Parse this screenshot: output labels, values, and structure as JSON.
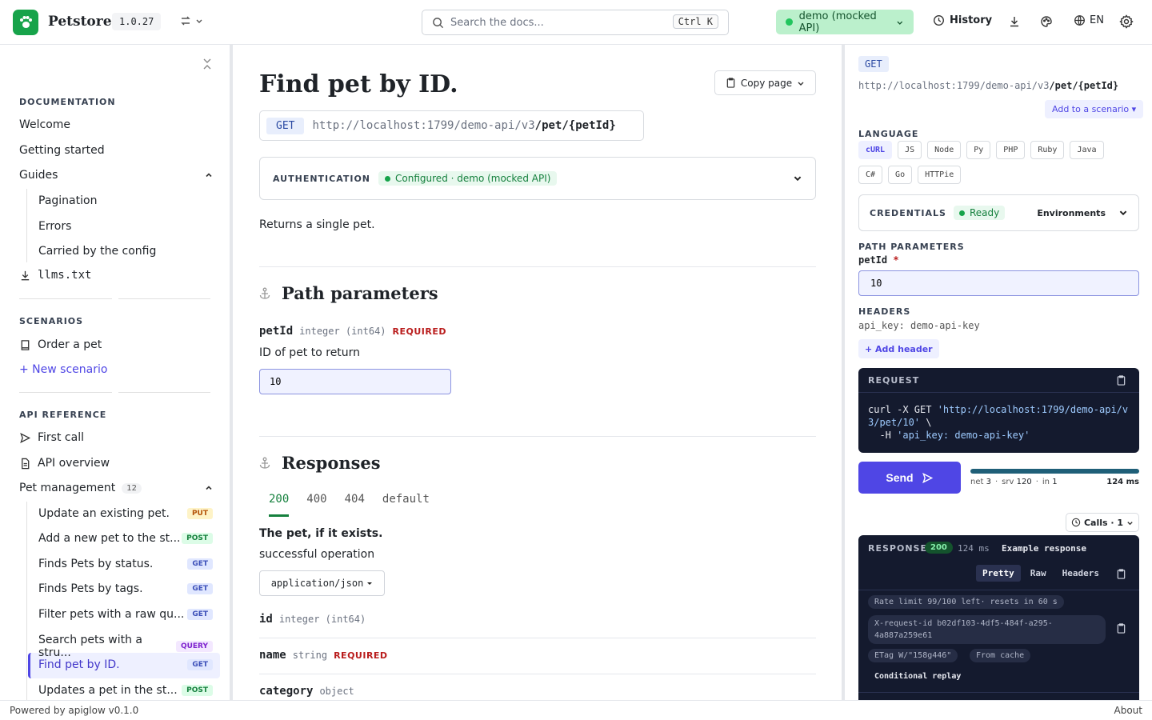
{
  "header": {
    "brand": "Petstore",
    "version": "1.0.27",
    "search_placeholder": "Search the docs...",
    "search_shortcut": "Ctrl K",
    "environment": "demo (mocked API)",
    "history_label": "History",
    "language": "EN"
  },
  "sidebar": {
    "documentation_heading": "DOCUMENTATION",
    "documentation_items": [
      "Welcome",
      "Getting started",
      "Guides"
    ],
    "guides_children": [
      "Pagination",
      "Errors",
      "Carried by the config"
    ],
    "llms_label": "llms.txt",
    "scenarios_heading": "SCENARIOS",
    "scenario_item": "Order a pet",
    "new_scenario": "+ New scenario",
    "api_heading": "API REFERENCE",
    "first_call": "First call",
    "api_overview": "API overview",
    "pet_group": "Pet management",
    "pet_group_count": "12",
    "endpoints": [
      {
        "label": "Update an existing pet.",
        "method": "PUT"
      },
      {
        "label": "Add a new pet to the st...",
        "method": "POST"
      },
      {
        "label": "Finds Pets by status.",
        "method": "GET"
      },
      {
        "label": "Finds Pets by tags.",
        "method": "GET"
      },
      {
        "label": "Filter pets with a raw qu...",
        "method": "GET"
      },
      {
        "label": "Search pets with a stru...",
        "method": "QUERY"
      },
      {
        "label": "Find pet by ID.",
        "method": "GET"
      },
      {
        "label": "Updates a pet in the st...",
        "method": "POST"
      }
    ]
  },
  "main": {
    "title": "Find pet by ID.",
    "copy_label": "Copy page",
    "method": "GET",
    "url_base": "http://localhost:1799/demo-api/v3",
    "url_path": "/pet/{petId}",
    "auth_label": "AUTHENTICATION",
    "auth_status": "Configured · demo (mocked API)",
    "description": "Returns a single pet.",
    "path_params_heading": "Path parameters",
    "param_name": "petId",
    "param_type": "integer (int64)",
    "param_required": "REQUIRED",
    "param_desc": "ID of pet to return",
    "param_value": "10",
    "responses_heading": "Responses",
    "response_codes": [
      "200",
      "400",
      "404",
      "default"
    ],
    "response_title": "The pet, if it exists.",
    "response_desc": "successful operation",
    "content_type": "application/json",
    "fields": [
      {
        "name": "id",
        "type": "integer (int64)",
        "required": ""
      },
      {
        "name": "name",
        "type": "string",
        "required": "REQUIRED"
      },
      {
        "name": "category",
        "type": "object",
        "required": ""
      }
    ]
  },
  "panel": {
    "method": "GET",
    "url_base": "http://localhost:1799/demo-api/v3",
    "url_path": "/pet/{petId}",
    "add_scenario": "Add to a scenario ▾",
    "language_heading": "LANGUAGE",
    "languages": [
      "cURL",
      "JS",
      "Node",
      "Py",
      "PHP",
      "Ruby",
      "Java",
      "C#",
      "Go",
      "HTTPie"
    ],
    "credentials_label": "CREDENTIALS",
    "credentials_status": "Ready",
    "environments_label": "Environments",
    "path_params_heading": "PATH PARAMETERS",
    "param_name": "petId",
    "param_value": "10",
    "headers_heading": "HEADERS",
    "header_line": "api_key: demo-api-key",
    "add_header": "+ Add header",
    "request_label": "REQUEST",
    "code_l1a": "curl -X GET ",
    "code_l1b": "'http://localhost:1799/demo-api/v",
    "code_l2a": "3/pet/10'",
    "code_l2b": " \\",
    "code_l3a": "  -H ",
    "code_l3b": "'api_key: demo-api-key'",
    "send_label": "Send",
    "progress_fraction": 1.0,
    "timing_net_label": "net",
    "timing_net": "3",
    "timing_srv_label": "srv",
    "timing_srv": "120",
    "timing_in_label": "in",
    "timing_in": "1",
    "timing_total": "124 ms",
    "calls_label": "Calls · 1",
    "response_label": "RESPONSE",
    "response_code": "200",
    "response_ms": "124 ms",
    "example_label": "Example response",
    "response_tabs": [
      "Pretty",
      "Raw",
      "Headers"
    ],
    "rate_limit": "Rate limit 99/100 left· resets in 60 s",
    "request_id_l1": "X-request-id b02df103-4df5-484f-a295-",
    "request_id_l2": "4a887a259e61",
    "etag": "ETag W/\"158g446\"",
    "from_cache": "From cache",
    "conditional_replay": "Conditional replay"
  },
  "footer": {
    "powered": "Powered by apiglow v0.1.0",
    "about": "About"
  }
}
